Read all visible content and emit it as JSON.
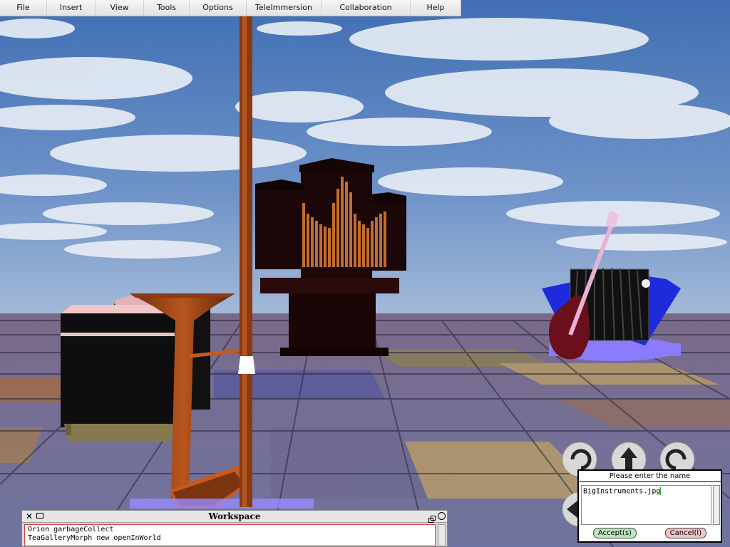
{
  "menubar": {
    "items": [
      "File",
      "Insert",
      "View",
      "Tools",
      "Options",
      "TeleImmersion",
      "Collaboration",
      "Help"
    ]
  },
  "workspace": {
    "title": "Workspace",
    "lines": [
      "Orion garbageCollect",
      "TeaGalleryMorph new openInWorld"
    ]
  },
  "dialog": {
    "title": "Please enter the name",
    "input_value": "BigInstruments.jpg",
    "accept_label": "Accept(s)",
    "cancel_label": "Cancel(l)"
  },
  "icons": {
    "workspace_close": "close-icon",
    "workspace_menu": "window-menu-icon",
    "workspace_collapse": "collapse-icon",
    "workspace_expand": "expand-icon",
    "nav_rotate_left": "rotate-left-icon",
    "nav_forward": "arrow-up-icon",
    "nav_rotate_right": "rotate-right-icon",
    "nav_left": "arrow-left-icon"
  },
  "colors": {
    "sky": "#5f86c0",
    "floor_tile_blue": "#5a5a9c",
    "floor_tile_tan": "#b59a6a",
    "accept": "#bfe7bf",
    "cancel": "#f3c4c4"
  }
}
